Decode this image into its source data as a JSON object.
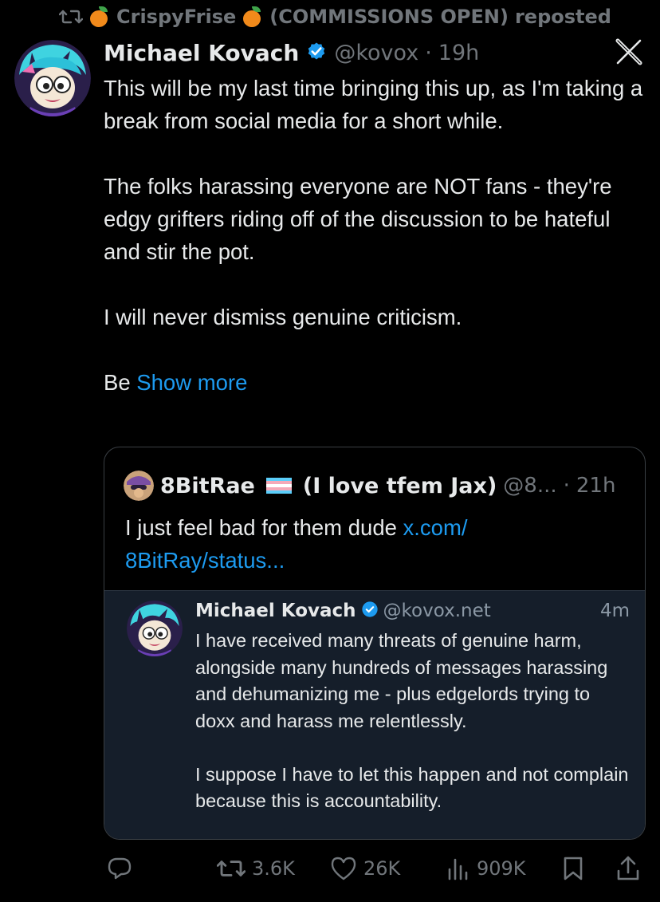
{
  "repost_bar": {
    "user_prefix": "CrispyFrise",
    "user_suffix": "(COMMISSIONS OPEN)",
    "action": "reposted"
  },
  "tweet": {
    "author_name": "Michael Kovach",
    "handle": "@kovox",
    "separator": "·",
    "time": "19h",
    "paragraphs": [
      "This will be my last time bringing this up, as I'm taking a break from social media for a short while.",
      "The folks harassing everyone are NOT fans - they're edgy grifters riding off of the discussion to be hateful and stir the pot.",
      "I will never dismiss genuine criticism."
    ],
    "truncated_start": "Be ",
    "show_more": "Show more"
  },
  "quote": {
    "author_name": "8BitRae",
    "author_suffix": "(I love tfem Jax)",
    "handle": "@8...",
    "separator": "·",
    "time": "21h",
    "text": "I just feel bad for them dude ",
    "link_line1": "x.com/",
    "link_line2": "8BitRay/status..."
  },
  "embedded": {
    "author_name": "Michael Kovach",
    "handle": "@kovox.net",
    "time": "4m",
    "paragraphs": [
      "I have received many threats of genuine harm, alongside many hundreds of messages harassing and dehumanizing me - plus edgelords trying to doxx and harass me relentlessly.",
      "I suppose I have to let this happen and not complain because this is accountability."
    ]
  },
  "actions": {
    "retweets": "3.6K",
    "likes": "26K",
    "views": "909K"
  },
  "colors": {
    "background": "#000000",
    "accent": "#1d9bf0",
    "muted": "#71767b",
    "embedded_bg": "#151e2a"
  },
  "icons": [
    "repost-icon",
    "orange-emoji-icon",
    "verified-badge-icon",
    "x-logo-icon",
    "trans-flag-icon",
    "reply-icon",
    "retweet-icon",
    "like-icon",
    "views-icon",
    "bookmark-icon",
    "share-icon"
  ]
}
